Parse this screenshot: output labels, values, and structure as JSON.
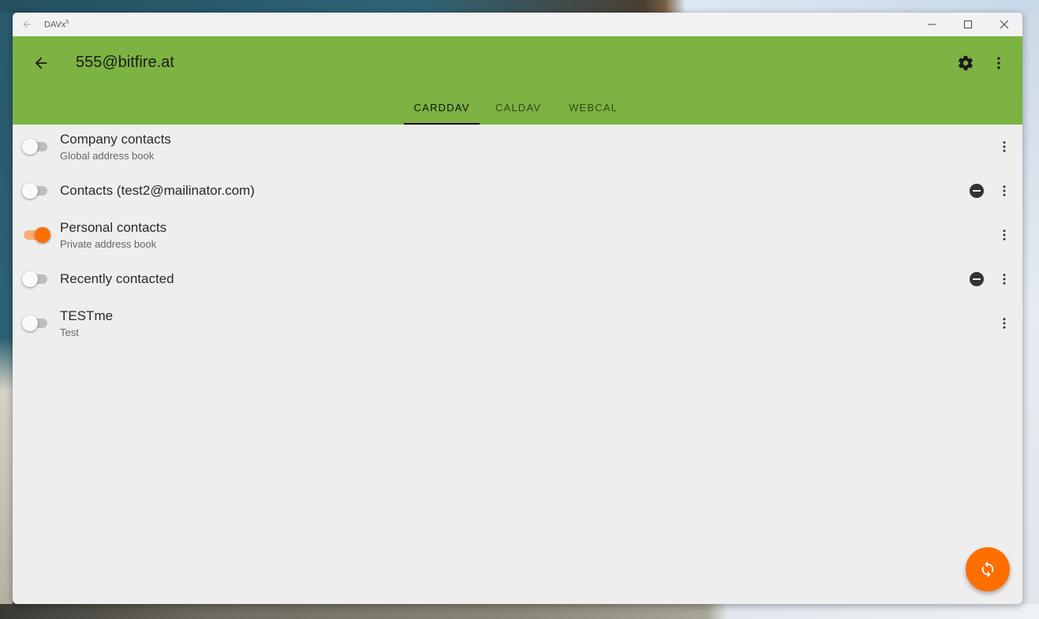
{
  "window": {
    "app_name": "DAVx",
    "app_name_sup": "5"
  },
  "appbar": {
    "title": "555@bitfire.at",
    "back_icon": "arrow-back-icon",
    "settings_icon": "gear-icon",
    "more_icon": "more-vert-icon"
  },
  "tabs": [
    {
      "label": "CARDDAV",
      "active": true
    },
    {
      "label": "CALDAV",
      "active": false
    },
    {
      "label": "WEBCAL",
      "active": false
    }
  ],
  "collections": [
    {
      "title": "Company contacts",
      "subtitle": "Global address book",
      "enabled": false,
      "read_only": false
    },
    {
      "title": "Contacts (test2@mailinator.com)",
      "subtitle": "",
      "enabled": false,
      "read_only": true
    },
    {
      "title": "Personal contacts",
      "subtitle": "Private address book",
      "enabled": true,
      "read_only": false
    },
    {
      "title": "Recently contacted",
      "subtitle": "",
      "enabled": false,
      "read_only": true
    },
    {
      "title": "TESTme",
      "subtitle": "Test",
      "enabled": false,
      "read_only": false
    }
  ],
  "fab": {
    "icon": "sync-icon"
  },
  "colors": {
    "appbar": "#7cb342",
    "accent": "#ff6f00",
    "background": "#eeeeee"
  }
}
